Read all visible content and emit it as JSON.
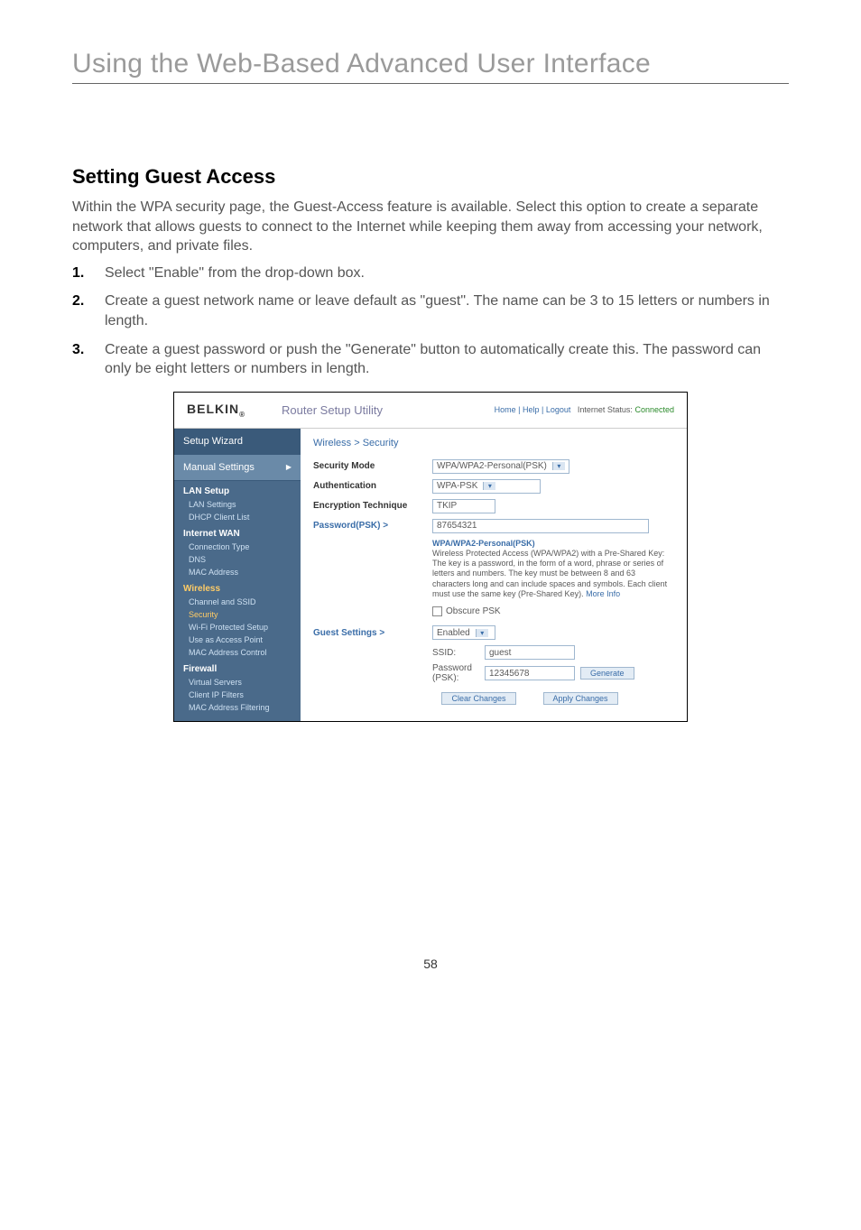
{
  "chapterTitle": "Using the Web-Based Advanced User Interface",
  "sectionTitle": "Setting Guest Access",
  "intro": "Within the WPA security page, the Guest-Access feature is available. Select this option to create a separate network that allows guests to connect to the Internet while keeping them away from accessing your network, computers, and private files.",
  "steps": [
    "Select \"Enable\" from the drop-down box.",
    "Create a guest network name or leave default as \"guest\". The name can be 3 to 15 letters or numbers in length.",
    "Create a guest password or push the \"Generate\" button to automatically create this. The password can only be eight letters or numbers in length."
  ],
  "shot": {
    "logo": "BELKIN",
    "utilityTitle": "Router Setup Utility",
    "headerLinks": "Home | Help | Logout",
    "statusLabel": "Internet Status:",
    "statusValue": "Connected",
    "sidebar": {
      "setupWizard": "Setup Wizard",
      "manualSettings": "Manual Settings",
      "groups": [
        {
          "head": "LAN Setup",
          "items": [
            "LAN Settings",
            "DHCP Client List"
          ]
        },
        {
          "head": "Internet WAN",
          "items": [
            "Connection Type",
            "DNS",
            "MAC Address"
          ]
        },
        {
          "head": "Wireless",
          "items": [
            "Channel and SSID",
            "Security",
            "Wi-Fi Protected Setup",
            "Use as Access Point",
            "MAC Address Control"
          ],
          "highlight": "Security"
        },
        {
          "head": "Firewall",
          "items": [
            "Virtual Servers",
            "Client IP Filters",
            "MAC Address Filtering"
          ]
        }
      ],
      "hiHead": "Wireless"
    },
    "content": {
      "breadcrumb": "Wireless > Security",
      "securityModeLabel": "Security Mode",
      "securityModeValue": "WPA/WPA2-Personal(PSK)",
      "authLabel": "Authentication",
      "authValue": "WPA-PSK",
      "encLabel": "Encryption Technique",
      "encValue": "TKIP",
      "pskLabel": "Password(PSK) >",
      "pskValue": "87654321",
      "helpTitle": "WPA/WPA2-Personal(PSK)",
      "helpBody": "Wireless Protected Access (WPA/WPA2) with a Pre-Shared Key: The key is a password, in the form of a word, phrase or series of letters and numbers. The key must be between 8 and 63 characters long and can include spaces and symbols. Each client must use the same key (Pre-Shared Key).",
      "helpMore": "More Info",
      "obscureLabel": "Obscure PSK",
      "guestLabel": "Guest Settings >",
      "guestEnabled": "Enabled",
      "ssidLabel": "SSID:",
      "ssidValue": "guest",
      "pwdLabel": "Password (PSK):",
      "pwdValue": "12345678",
      "generate": "Generate",
      "clear": "Clear Changes",
      "apply": "Apply Changes"
    }
  },
  "pageNumber": "58"
}
